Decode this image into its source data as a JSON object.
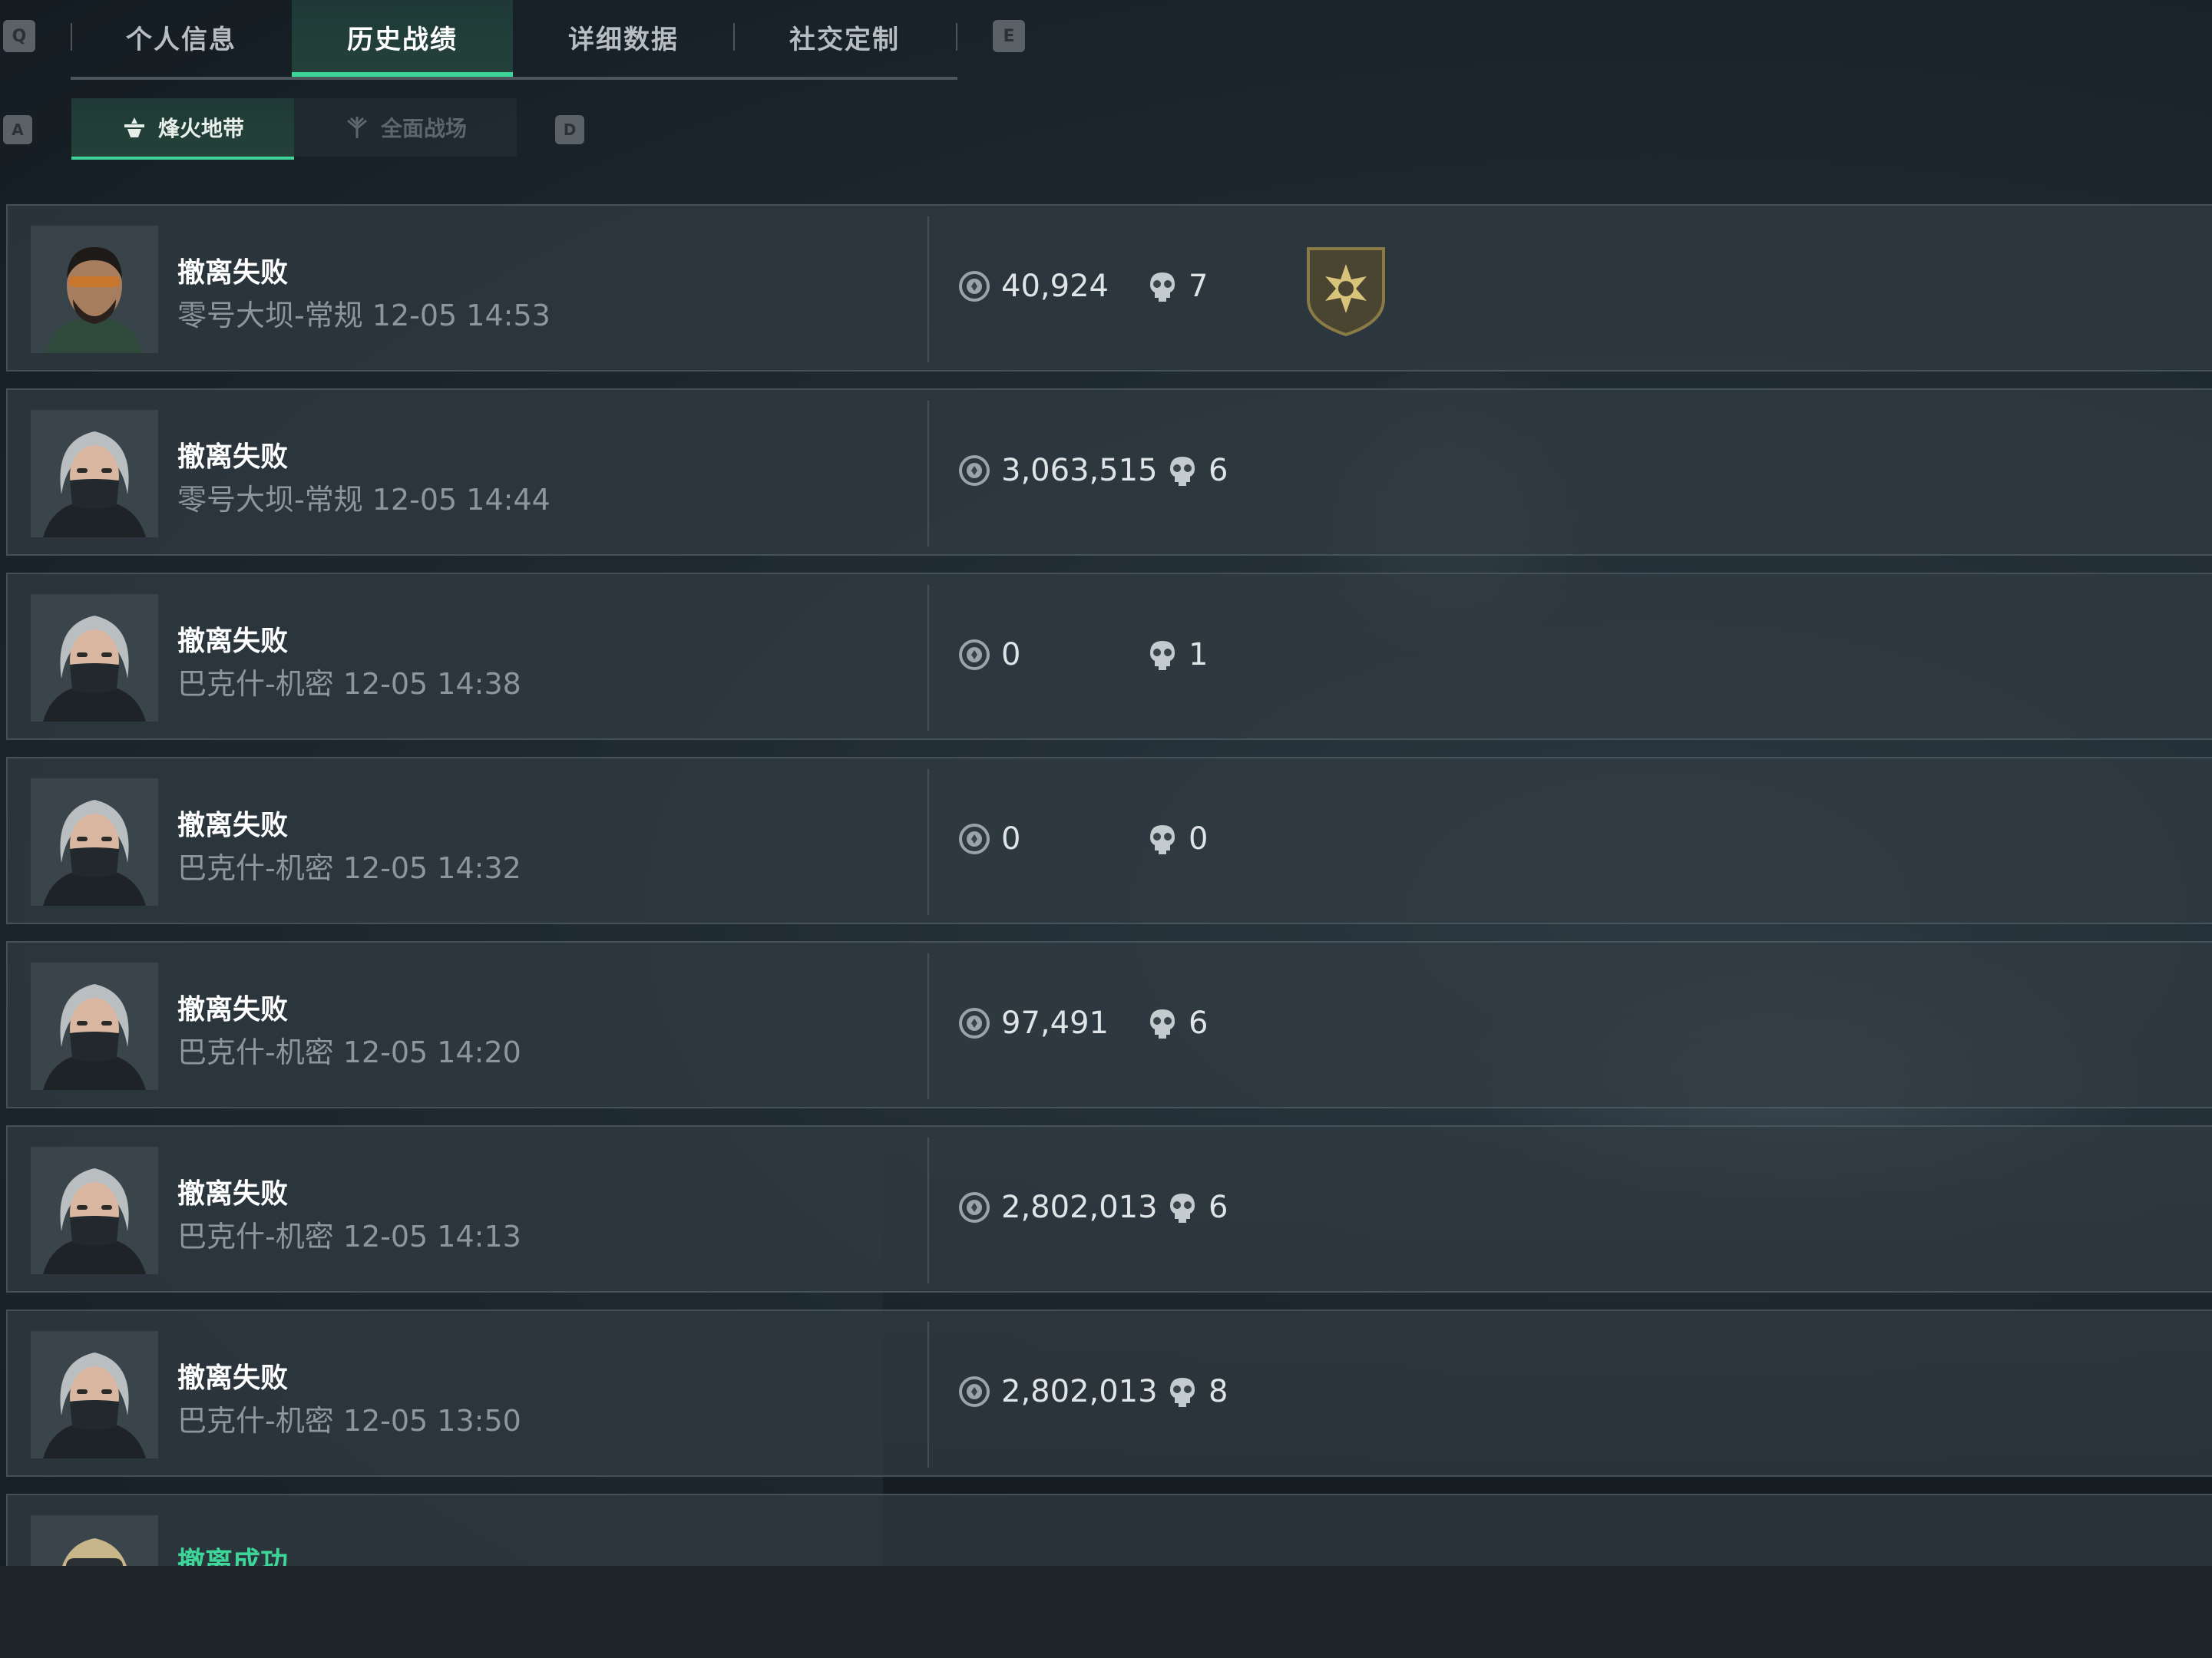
{
  "header": {
    "left_key": "Q",
    "right_key": "E",
    "tabs": [
      {
        "label": "个人信息",
        "active": false
      },
      {
        "label": "历史战绩",
        "active": true
      },
      {
        "label": "详细数据",
        "active": false
      },
      {
        "label": "社交定制",
        "active": false
      }
    ]
  },
  "subheader": {
    "left_key": "A",
    "right_key": "D",
    "tabs": [
      {
        "label": "烽火地带",
        "icon": "mode-extraction-icon",
        "active": true
      },
      {
        "label": "全面战场",
        "icon": "mode-battlefield-icon",
        "active": false
      }
    ]
  },
  "colors": {
    "accent": "#3dd598",
    "success_text": "#3dd598",
    "fail_text": "#ffffff"
  },
  "matches": [
    {
      "status": "撤离失败",
      "success": false,
      "map": "零号大坝-常规 12-05 14:53",
      "value": "40,924",
      "kills": "7",
      "badge": true,
      "avatar": "operator-bearded"
    },
    {
      "status": "撤离失败",
      "success": false,
      "map": "零号大坝-常规 12-05 14:44",
      "value": "3,063,515",
      "kills": "6",
      "badge": false,
      "avatar": "operator-masked"
    },
    {
      "status": "撤离失败",
      "success": false,
      "map": "巴克什-机密 12-05 14:38",
      "value": "0",
      "kills": "1",
      "badge": false,
      "avatar": "operator-masked"
    },
    {
      "status": "撤离失败",
      "success": false,
      "map": "巴克什-机密 12-05 14:32",
      "value": "0",
      "kills": "0",
      "badge": false,
      "avatar": "operator-masked"
    },
    {
      "status": "撤离失败",
      "success": false,
      "map": "巴克什-机密 12-05 14:20",
      "value": "97,491",
      "kills": "6",
      "badge": false,
      "avatar": "operator-masked"
    },
    {
      "status": "撤离失败",
      "success": false,
      "map": "巴克什-机密 12-05 14:13",
      "value": "2,802,013",
      "kills": "6",
      "badge": false,
      "avatar": "operator-masked"
    },
    {
      "status": "撤离失败",
      "success": false,
      "map": "巴克什-机密 12-05 13:50",
      "value": "2,802,013",
      "kills": "8",
      "badge": false,
      "avatar": "operator-masked"
    },
    {
      "status": "撤离成功",
      "success": true,
      "map": "",
      "value": "",
      "kills": "",
      "badge": false,
      "avatar": "operator-goggles"
    }
  ]
}
